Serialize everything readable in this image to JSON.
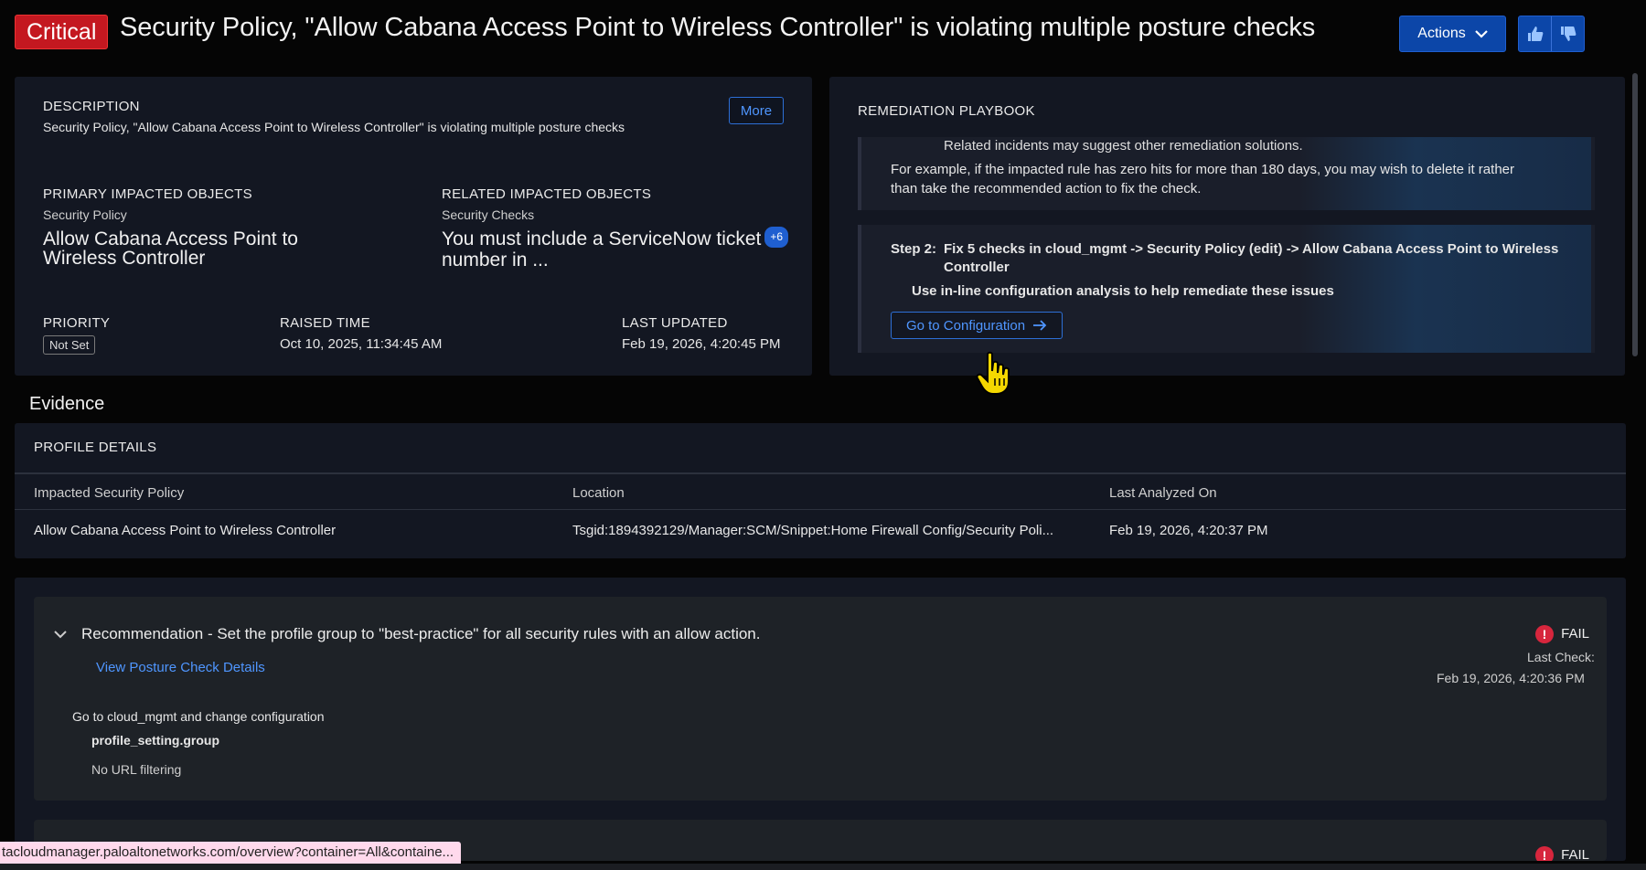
{
  "header": {
    "severity": "Critical",
    "title": "Security Policy, \"Allow Cabana Access Point to Wireless Controller\" is violating multiple posture checks",
    "actions_label": "Actions"
  },
  "summary": {
    "description_label": "DESCRIPTION",
    "description": "Security Policy, \"Allow Cabana Access Point to Wireless Controller\" is violating multiple posture checks",
    "more_label": "More",
    "primary_label": "PRIMARY IMPACTED OBJECTS",
    "primary_type": "Security Policy",
    "primary_value_line1": "Allow Cabana Access Point to",
    "primary_value_line2": "Wireless Controller",
    "related_label": "RELATED IMPACTED OBJECTS",
    "related_type": "Security Checks",
    "related_value_line1": "You must include a ServiceNow ticket",
    "related_value_line2": "number in ...",
    "related_count": "+6",
    "priority_label": "PRIORITY",
    "priority_value": "Not Set",
    "raised_label": "RAISED TIME",
    "raised_value": "Oct 10, 2025, 11:34:45 AM",
    "updated_label": "LAST UPDATED",
    "updated_value": "Feb 19, 2026, 4:20:45 PM"
  },
  "playbook": {
    "label": "REMEDIATION PLAYBOOK",
    "step1_partial": "Related incidents may suggest other remediation solutions.",
    "step1_example_line1": "For example, if the impacted rule has zero hits for more than 180 days, you may wish to delete it rather",
    "step1_example_line2": "than take the recommended action to fix the check.",
    "step2_prefix": "Step 2:",
    "step2_text_line1": "Fix 5 checks in cloud_mgmt -> Security Policy (edit) -> Allow Cabana Access Point to Wireless",
    "step2_text_line2": "Controller",
    "step2_sub": "Use in-line configuration analysis to help remediate these issues",
    "goto_label": "Go to Configuration"
  },
  "evidence": {
    "title": "Evidence",
    "profile_label": "PROFILE DETAILS",
    "columns": [
      "Impacted Security Policy",
      "Location",
      "Last Analyzed On"
    ],
    "row": [
      "Allow Cabana Access Point to Wireless Controller",
      "Tsgid:1894392129/Manager:SCM/Snippet:Home Firewall Config/Security Poli...",
      "Feb 19, 2026, 4:20:37 PM"
    ]
  },
  "recommendation": {
    "title": "Recommendation - Set the profile group to \"best-practice\" for all security rules with an allow action.",
    "link": "View Posture Check Details",
    "status": "FAIL",
    "last_check_label": "Last Check:",
    "last_check_value": "Feb 19, 2026, 4:20:36 PM",
    "goto_text": "Go to cloud_mgmt and change configuration",
    "setting": "profile_setting.group",
    "setting_value": "No URL filtering",
    "next_status": "FAIL"
  },
  "statusbar": {
    "url": "tacloudmanager.paloaltonetworks.com/overview?container=All&containe..."
  },
  "colors": {
    "critical": "#c41820",
    "accent": "#0c46a8",
    "link": "#4f96ff",
    "fail": "#d7263d"
  },
  "icons": [
    "chevron-down-icon",
    "thumbs-up-icon",
    "thumbs-down-icon",
    "arrow-right-icon",
    "hand-pointer-icon",
    "error-icon"
  ]
}
